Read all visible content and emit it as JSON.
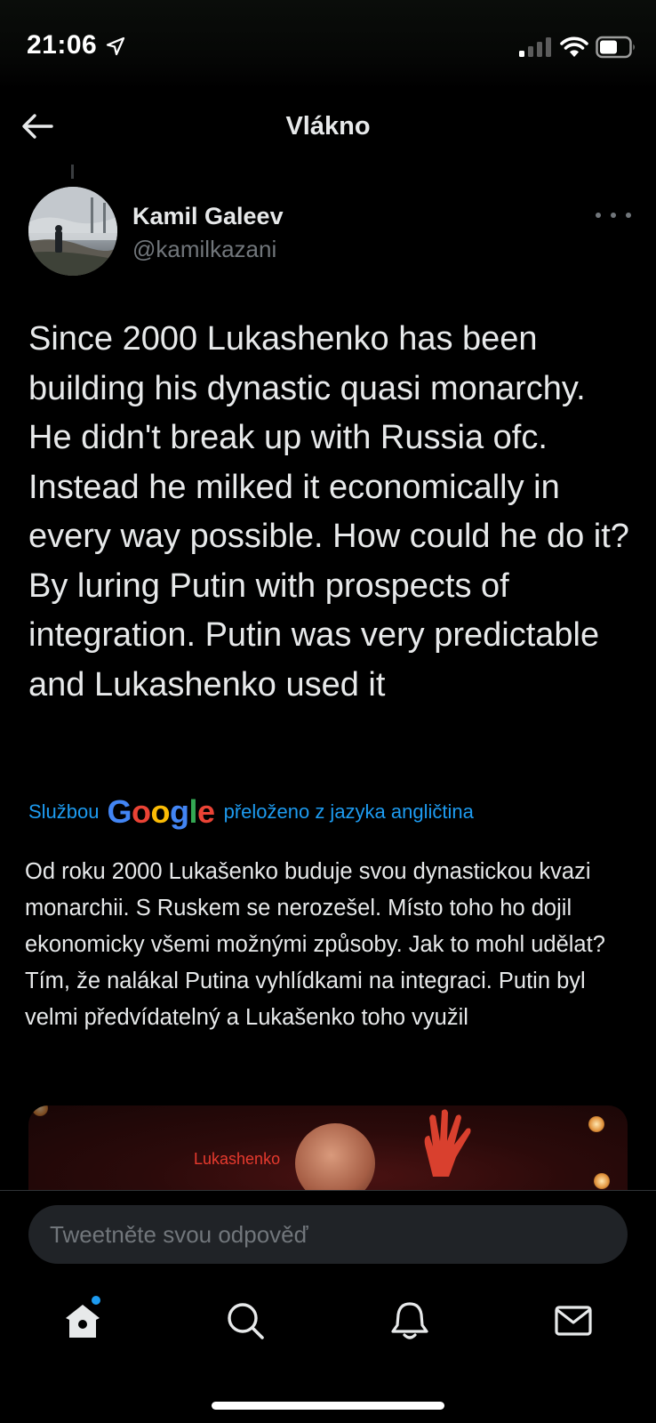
{
  "status_bar": {
    "time": "21:06"
  },
  "header": {
    "title": "Vlákno"
  },
  "tweet": {
    "author_name": "Kamil Galeev",
    "author_handle": "@kamilkazani",
    "text": "Since 2000 Lukashenko has been building his dynastic quasi monarchy. He didn't break up with Russia ofc. Instead he milked it economically in every way possible. How could he do it? By luring Putin with prospects of integration. Putin was very predictable and Lukashenko used it",
    "translation_prefix": "Službou",
    "translation_suffix": "přeloženo z jazyka angličtina",
    "translated_text": "Od roku 2000 Lukašenko buduje svou dynastickou kvazi monarchii. S Ruskem se nerozešel. Místo toho ho dojil ekonomicky všemi možnými způsoby. Jak to mohl udělat? Tím, že nalákal Putina vyhlídkami na integraci. Putin byl velmi předvídatelný a Lukašenko toho využil",
    "media_label": "Lukashenko"
  },
  "google_logo": {
    "letters": [
      "G",
      "o",
      "o",
      "g",
      "l",
      "e"
    ],
    "colors": [
      "#4285f4",
      "#ea4335",
      "#fbbc05",
      "#4285f4",
      "#34a853",
      "#ea4335"
    ]
  },
  "reply": {
    "placeholder": "Tweetněte svou odpověď"
  },
  "tab_bar": {
    "icons": [
      "home-icon",
      "search-icon",
      "bell-icon",
      "mail-icon"
    ],
    "home_has_notification_dot": true
  },
  "colors": {
    "background": "#000000",
    "accent": "#1d9bf0",
    "text_primary": "#e7e9ea",
    "text_secondary": "#71767b"
  }
}
